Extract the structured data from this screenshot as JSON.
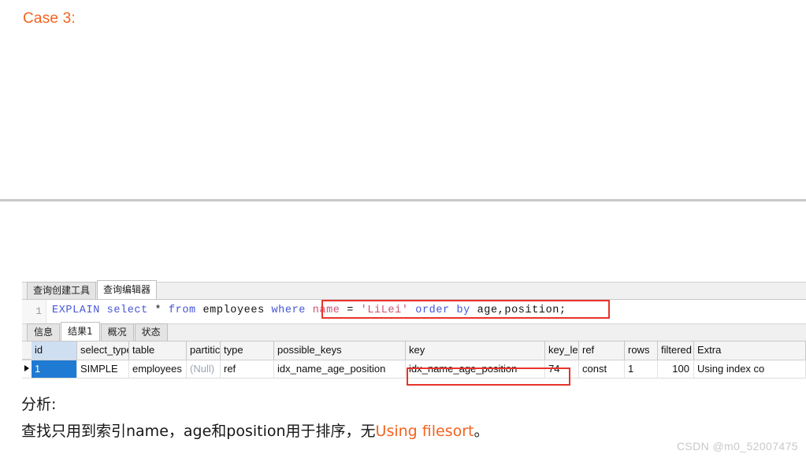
{
  "slide": {
    "title": "Case 3:",
    "title_color": "#f4631e",
    "divider": true
  },
  "db_client": {
    "editor_tabs": [
      {
        "label": "查询创建工具",
        "active": false
      },
      {
        "label": "查询编辑器",
        "active": true
      }
    ],
    "sql": {
      "line_number": "1",
      "tokens": [
        {
          "text": "EXPLAIN",
          "kind": "keyword"
        },
        {
          "text": " ",
          "kind": "space"
        },
        {
          "text": "select",
          "kind": "keyword"
        },
        {
          "text": " ",
          "kind": "space"
        },
        {
          "text": "*",
          "kind": "operator"
        },
        {
          "text": " ",
          "kind": "space"
        },
        {
          "text": "from",
          "kind": "keyword"
        },
        {
          "text": " ",
          "kind": "space"
        },
        {
          "text": "employees",
          "kind": "identifier"
        },
        {
          "text": " ",
          "kind": "space"
        },
        {
          "text": "where",
          "kind": "keyword"
        },
        {
          "text": " ",
          "kind": "space"
        },
        {
          "text": "name",
          "kind": "str"
        },
        {
          "text": " = ",
          "kind": "operator"
        },
        {
          "text": "'LiLei'",
          "kind": "str"
        },
        {
          "text": " ",
          "kind": "space"
        },
        {
          "text": "order",
          "kind": "keyword"
        },
        {
          "text": " ",
          "kind": "space"
        },
        {
          "text": "by",
          "kind": "keyword"
        },
        {
          "text": " ",
          "kind": "space"
        },
        {
          "text": "age,position;",
          "kind": "identifier"
        }
      ],
      "full_text": "EXPLAIN select * from employees where name = 'LiLei' order by age,position;",
      "highlight_fragment": "name = 'LiLei' order by age,position;",
      "highlight_color": "#e8342a"
    },
    "result_tabs": [
      {
        "label": "信息",
        "active": false
      },
      {
        "label": "结果1",
        "active": true
      },
      {
        "label": "概况",
        "active": false
      },
      {
        "label": "状态",
        "active": false
      }
    ],
    "result_grid": {
      "columns": [
        {
          "label": "id",
          "width": 58,
          "selected": true
        },
        {
          "label": "select_type",
          "width": 66,
          "selected": false
        },
        {
          "label": "table",
          "width": 73,
          "selected": false
        },
        {
          "label": "partitic",
          "width": 43,
          "selected": false
        },
        {
          "label": "type",
          "width": 68,
          "selected": false
        },
        {
          "label": "possible_keys",
          "width": 167,
          "selected": false
        },
        {
          "label": "key",
          "width": 177,
          "selected": false
        },
        {
          "label": "key_len",
          "width": 43,
          "selected": false
        },
        {
          "label": "ref",
          "width": 58,
          "selected": false
        },
        {
          "label": "rows",
          "width": 42,
          "selected": false
        },
        {
          "label": "filtered",
          "width": 46,
          "selected": false
        },
        {
          "label": "Extra",
          "width": 142,
          "selected": false
        }
      ],
      "rows": [
        {
          "marker": true,
          "cells": [
            {
              "value": "1",
              "selected": true,
              "null": false,
              "numeric": false
            },
            {
              "value": "SIMPLE",
              "selected": false,
              "null": false,
              "numeric": false
            },
            {
              "value": "employees",
              "selected": false,
              "null": false,
              "numeric": false
            },
            {
              "value": "(Null)",
              "selected": false,
              "null": true,
              "numeric": false
            },
            {
              "value": "ref",
              "selected": false,
              "null": false,
              "numeric": false
            },
            {
              "value": "idx_name_age_position",
              "selected": false,
              "null": false,
              "numeric": false
            },
            {
              "value": "idx_name_age_position",
              "selected": false,
              "null": false,
              "numeric": false
            },
            {
              "value": "74",
              "selected": false,
              "null": false,
              "numeric": false
            },
            {
              "value": "const",
              "selected": false,
              "null": false,
              "numeric": false
            },
            {
              "value": "1",
              "selected": false,
              "null": false,
              "numeric": false
            },
            {
              "value": "100",
              "selected": false,
              "null": false,
              "numeric": true
            },
            {
              "value": "Using index co",
              "selected": false,
              "null": false,
              "numeric": false
            }
          ]
        }
      ],
      "key_highlight": {
        "columns": [
          "key",
          "key_len"
        ],
        "color": "#e8342a"
      }
    }
  },
  "analysis": {
    "label": "分析:",
    "text_before": "查找只用到索引name，age和position用于排序，无",
    "emphasis": "Using filesort",
    "emphasis_color": "#f4631e",
    "text_after": "。"
  },
  "watermark": {
    "text": "CSDN @m0_52007475"
  }
}
